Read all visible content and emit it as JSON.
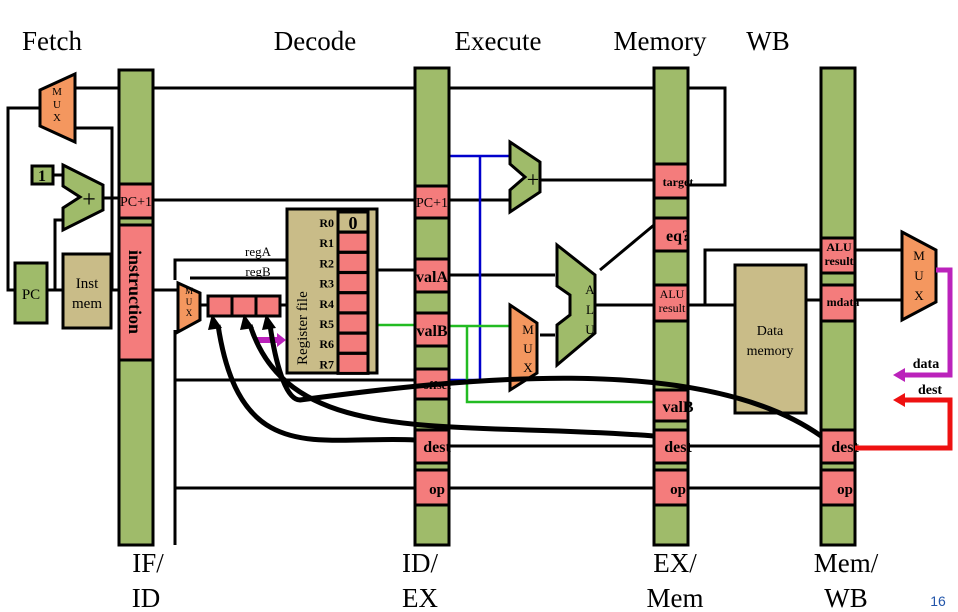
{
  "stages": {
    "fetch": "Fetch",
    "decode": "Decode",
    "execute": "Execute",
    "memory": "Memory",
    "wb": "WB"
  },
  "pipeline_registers": {
    "ifid": {
      "label1": "IF/",
      "label2": "ID",
      "fields": {
        "pc1": "PC+1",
        "instruction": "instruction"
      }
    },
    "idex": {
      "label1": "ID/",
      "label2": "EX",
      "fields": {
        "pc1": "PC+1",
        "valA": "valA",
        "valB": "valB",
        "offset": "offset",
        "dest": "dest",
        "op": "op"
      }
    },
    "exmem": {
      "label1": "EX/",
      "label2": "Mem",
      "fields": {
        "target": "target",
        "eq": "eq?",
        "alu": "ALU result",
        "valB": "valB",
        "dest": "dest",
        "op": "op"
      }
    },
    "memwb": {
      "label1": "Mem/",
      "label2": "WB",
      "fields": {
        "alu": "ALU result",
        "mdata": "mdata",
        "dest": "dest",
        "op": "op"
      }
    }
  },
  "fetch": {
    "mux": "MUX",
    "one": "1",
    "pc": "PC",
    "inst_mem1": "Inst",
    "inst_mem2": "mem"
  },
  "decode": {
    "regA": "regA",
    "regB": "regB",
    "mux": "MUX",
    "register_file": "Register file",
    "registers": [
      "R0",
      "R1",
      "R2",
      "R3",
      "R4",
      "R5",
      "R6",
      "R7"
    ],
    "r0_value": "0"
  },
  "execute": {
    "mux": "MUX",
    "alu": "ALU"
  },
  "memory": {
    "data_memory1": "Data",
    "data_memory2": "memory"
  },
  "writeback": {
    "mux": "MUX",
    "data": "data",
    "dest": "dest"
  },
  "page_number": "16",
  "colors": {
    "register_green": "#9fbb6a",
    "field_pink": "#f47c7c",
    "mux_orange": "#f4975f",
    "memory_tan": "#c9bc88",
    "forward_blue": "#0000cc",
    "forward_green": "#22bb22",
    "data_purple": "#bb22bb",
    "dest_red": "#ee1111"
  }
}
